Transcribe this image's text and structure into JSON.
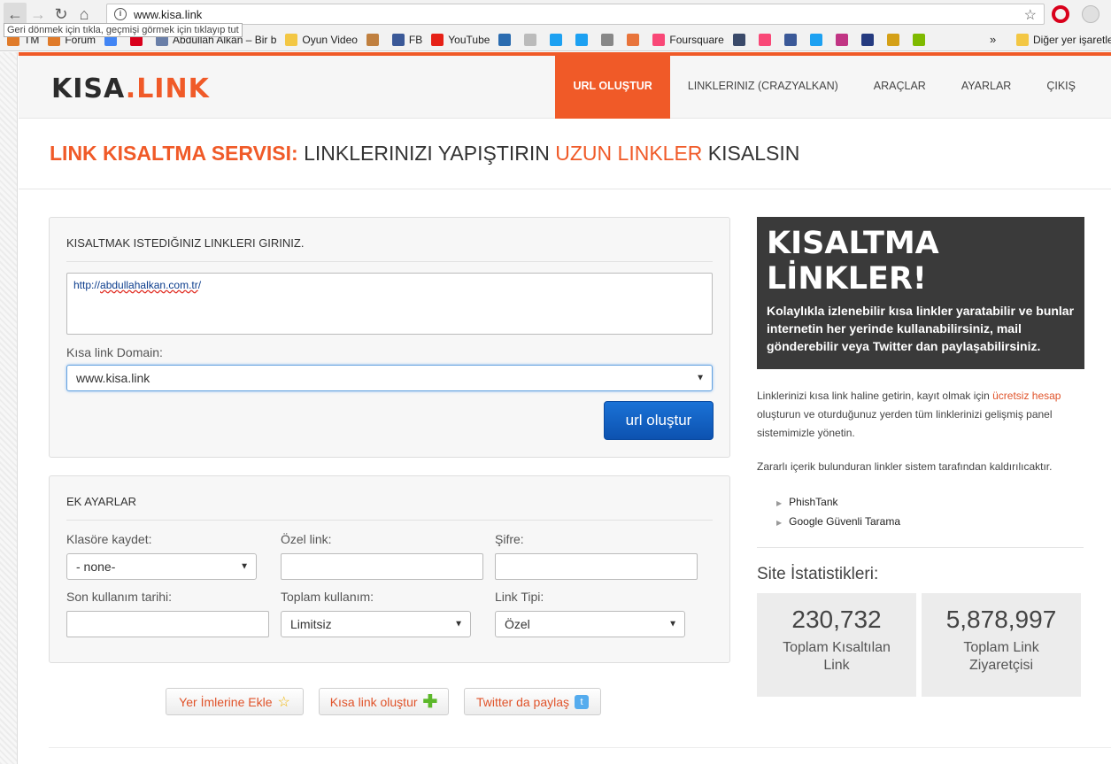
{
  "browser": {
    "url": "www.kisa.link",
    "tooltip": "Geri dönmek için tıkla, geçmişi görmek için tıklayıp tut",
    "bookmarks": [
      {
        "label": "TM",
        "color": "#e07b2a"
      },
      {
        "label": "Forum",
        "color": "#e07b2a"
      },
      {
        "label": "",
        "color": "#4285f4"
      },
      {
        "label": "",
        "color": "#d9001b"
      },
      {
        "label": "Abdullah Alkan – Bir b",
        "color": "#6a7fa8"
      },
      {
        "label": "Oyun Video",
        "color": "#f3c744"
      },
      {
        "label": "",
        "color": "#c08040"
      },
      {
        "label": "FB",
        "color": "#3b5998"
      },
      {
        "label": "YouTube",
        "color": "#e62117"
      },
      {
        "label": "",
        "color": "#2b6cb0"
      },
      {
        "label": "",
        "color": "#bbbbbb"
      },
      {
        "label": "",
        "color": "#1da1f2"
      },
      {
        "label": "",
        "color": "#1da1f2"
      },
      {
        "label": "",
        "color": "#888888"
      },
      {
        "label": "",
        "color": "#e8743b"
      },
      {
        "label": "Foursquare",
        "color": "#f94877"
      },
      {
        "label": "",
        "color": "#3a4a6a"
      },
      {
        "label": "",
        "color": "#f94877"
      },
      {
        "label": "",
        "color": "#3b5998"
      },
      {
        "label": "",
        "color": "#1da1f2"
      },
      {
        "label": "",
        "color": "#c13584"
      },
      {
        "label": "",
        "color": "#253b80"
      },
      {
        "label": "",
        "color": "#d4a017"
      },
      {
        "label": "",
        "color": "#7fba00"
      }
    ],
    "overflow": "»",
    "other_bookmarks": "Diğer yer işaretle"
  },
  "header": {
    "logo_part1": "KISA",
    "logo_part2": ".LINK",
    "menu": [
      {
        "label": "URL OLUŞTUR",
        "active": true
      },
      {
        "label": "LINKLERINIZ (CRAZYALKAN)",
        "active": false
      },
      {
        "label": "ARAÇLAR",
        "active": false
      },
      {
        "label": "AYARLAR",
        "active": false
      },
      {
        "label": "ÇIKIŞ",
        "active": false
      }
    ]
  },
  "banner": {
    "part1": "LINK KISALTMA SERVISI:",
    "part2": " LINKLERINIZI YAPIŞTIRIN ",
    "part3": "UZUN LINKLER",
    "part4": " KISALSIN"
  },
  "main_form": {
    "title": "KISALTMAK ISTEDIĞINIZ LINKLERI GIRINIZ.",
    "url_prefix": "http://",
    "url_rest": "abdullahalkan.com.tr",
    "url_suffix": "/",
    "domain_label": "Kısa link Domain:",
    "domain_value": "www.kisa.link",
    "submit_label": "url oluştur"
  },
  "extra": {
    "title": "EK AYARLAR",
    "folder_label": "Klasöre kaydet:",
    "folder_value": "- none-",
    "custom_label": "Özel link:",
    "password_label": "Şifre:",
    "expiry_label": "Son kullanım tarihi:",
    "usage_label": "Toplam kullanım:",
    "usage_value": "Limitsiz",
    "type_label": "Link Tipi:",
    "type_value": "Özel"
  },
  "actions": {
    "bookmark": "Yer İmlerine Ekle",
    "create": "Kısa link oluştur",
    "twitter": "Twitter da paylaş"
  },
  "sidebar": {
    "promo_title": "KISALTMA LİNKLER!",
    "promo_text": "Kolaylıkla izlenebilir kısa linkler yaratabilir ve bunlar internetin her yerinde kullanabilirsiniz, mail gönderebilir veya Twitter dan paylaşabilirsiniz.",
    "info_1a": "Linklerinizi kısa link haline getirin, kayıt olmak için ",
    "info_1_link": "ücretsiz hesap",
    "info_1b": " oluşturun ve oturduğunuz yerden tüm linklerinizi gelişmiş panel sistemimizle yönetin.",
    "info_2": "Zararlı içerik bulunduran linkler sistem tarafından kaldırılıcaktır.",
    "sources": [
      "PhishTank",
      "Google Güvenli Tarama"
    ],
    "stats_title": "Site İstatistikleri:",
    "stats": [
      {
        "value": "230,732",
        "caption": "Toplam Kısaltılan Link"
      },
      {
        "value": "5,878,997",
        "caption": "Toplam Link Ziyaretçisi"
      }
    ]
  },
  "colors": {
    "accent": "#f05a28",
    "primary_button": "#0d52b0",
    "promo_bg": "#3a3a3a"
  }
}
